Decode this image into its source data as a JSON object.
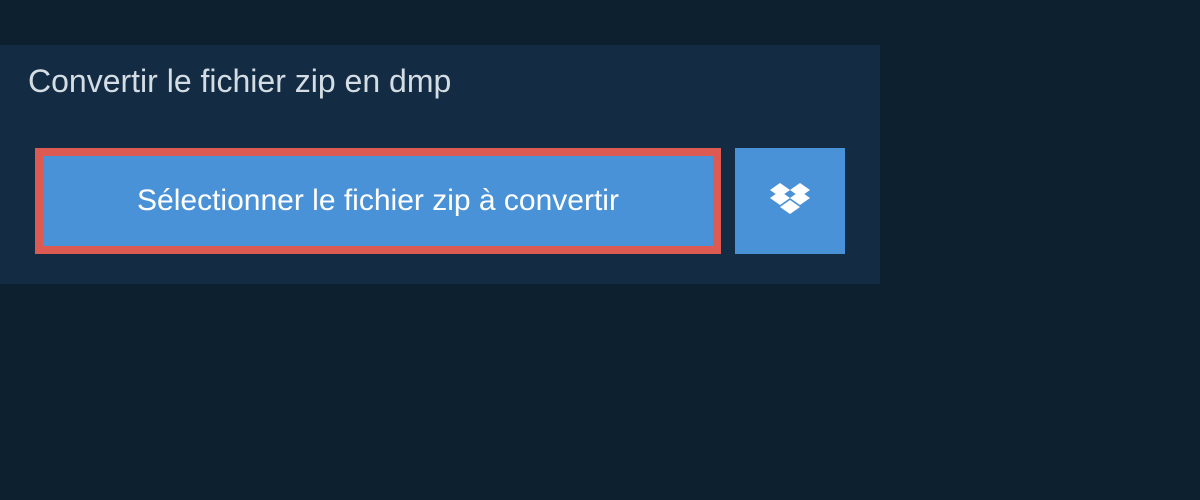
{
  "header": {
    "title": "Convertir le fichier zip en dmp"
  },
  "buttons": {
    "select_label": "Sélectionner le fichier zip à convertir"
  }
}
